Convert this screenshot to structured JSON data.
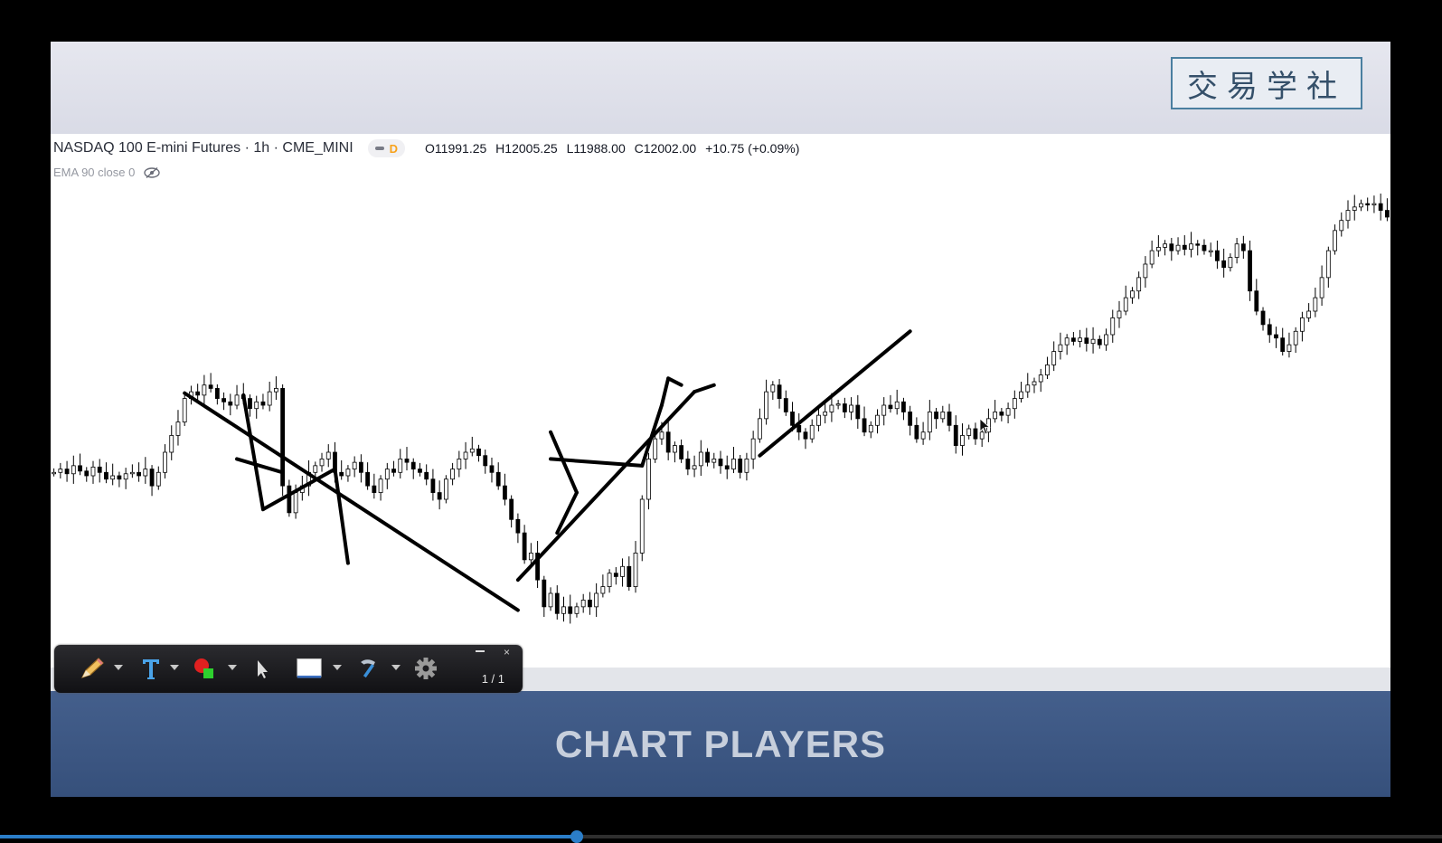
{
  "header": {
    "logo_text": "交易学社"
  },
  "chart": {
    "symbol": "NASDAQ 100 E-mini Futures · 1h · CME_MINI",
    "badge": "D",
    "ohlc": {
      "o_label": "O",
      "o": "11991.25",
      "h_label": "H",
      "h": "12005.25",
      "l_label": "L",
      "l": "11988.00",
      "c_label": "C",
      "c": "12002.00",
      "change": "+10.75 (+0.09%)"
    },
    "indicator": "EMA 90 close 0",
    "icons": [
      "eye-off-icon"
    ]
  },
  "chart_data": {
    "type": "candlestick",
    "series": [
      {
        "values": [
          11900,
          11905,
          11898,
          11910,
          11902,
          11895,
          11908,
          11900,
          11890,
          11895,
          11890,
          11898,
          11900,
          11895,
          11905,
          11880,
          11900,
          11930,
          11955,
          11975,
          12010,
          12020,
          12015,
          12030,
          12025,
          12010,
          12005,
          12000,
          12015,
          12010,
          11995,
          12005,
          12000,
          12020,
          12025,
          11880,
          11840,
          11870,
          11880,
          11900,
          11910,
          11920,
          11930,
          11900,
          11895,
          11905,
          11915,
          11900,
          11880,
          11870,
          11890,
          11905,
          11900,
          11920,
          11915,
          11905,
          11900,
          11890,
          11870,
          11860,
          11890,
          11905,
          11920,
          11930,
          11935,
          11925,
          11910,
          11900,
          11880,
          11860,
          11830,
          11810,
          11770,
          11780,
          11740,
          11700,
          11720,
          11690,
          11700,
          11690,
          11700,
          11710,
          11700,
          11720,
          11730,
          11750,
          11745,
          11760,
          11730,
          11780,
          11860,
          11920,
          11950,
          11960,
          11930,
          11940,
          11920,
          11905,
          11910,
          11930,
          11915,
          11920,
          11910,
          11905,
          11920,
          11900,
          11920,
          11950,
          11980,
          12020,
          12030,
          12010,
          11990,
          11970,
          11960,
          11950,
          11970,
          11985,
          11990,
          12000,
          12002,
          11990,
          12000,
          11980,
          11960,
          11970,
          11985,
          12000,
          11995,
          12005,
          11990,
          11970,
          11950,
          11960,
          11990,
          11980,
          11990,
          11970,
          11940,
          11955,
          11965,
          11950,
          11960,
          11980,
          11990,
          11985,
          11995,
          12010,
          12020,
          12030,
          12035,
          12045,
          12060,
          12080,
          12090,
          12100,
          12095,
          12100,
          12092,
          12098,
          12090,
          12105,
          12130,
          12140,
          12160,
          12170,
          12190,
          12210,
          12230,
          12235,
          12240,
          12230,
          12238,
          12232,
          12240,
          12238,
          12230,
          12230,
          12215,
          12205,
          12220,
          12240,
          12230,
          12170,
          12140,
          12120,
          12105,
          12100,
          12080,
          12090,
          12110,
          12130,
          12140,
          12160,
          12190,
          12230,
          12260,
          12275,
          12290,
          12295,
          12300,
          12298,
          12300,
          12290,
          12280
        ]
      }
    ],
    "xlabel": "",
    "ylabel": ""
  },
  "annotations": {
    "lines": 14
  },
  "toolbar": {
    "icons": [
      "pencil-icon",
      "text-tool-icon",
      "color-picker-icon",
      "pointer-icon",
      "whiteboard-icon",
      "hammer-icon",
      "gear-icon"
    ],
    "page_indicator": "1 / 1",
    "close_glyph": "×"
  },
  "banner": {
    "title": "CHART PLAYERS"
  },
  "progress": {
    "fraction": 0.4
  }
}
